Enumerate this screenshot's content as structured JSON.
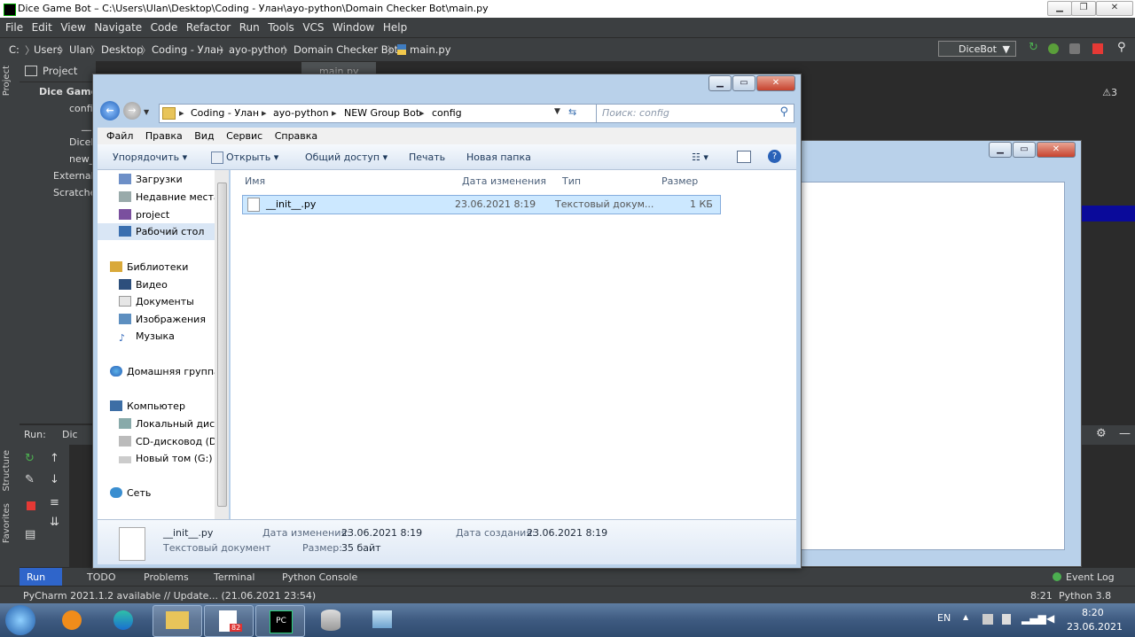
{
  "pycharm": {
    "title": "Dice Game Bot – C:\\Users\\Ulan\\Desktop\\Coding - Улан\\ayo-python\\Domain Checker Bot\\main.py",
    "menu": [
      "File",
      "Edit",
      "View",
      "Navigate",
      "Code",
      "Refactor",
      "Run",
      "Tools",
      "VCS",
      "Window",
      "Help"
    ],
    "breadcrumb": [
      "C:",
      "Users",
      "Ulan",
      "Desktop",
      "Coding - Улан",
      "ayo-python",
      "Domain Checker Bot",
      "main.py"
    ],
    "run_config": "DiceBot",
    "project_label": "Project",
    "tab": "main.py",
    "tree": [
      "Dice Game",
      "config",
      "__",
      "DiceB",
      "new_",
      "External",
      "Scratche"
    ],
    "warnings": "3",
    "run_label": "Run:",
    "run_tab": "Dic",
    "vertical_tabs": {
      "project": "Project",
      "structure": "Structure",
      "favorites": "Favorites"
    },
    "bottom_tabs": [
      "Run",
      "TODO",
      "Problems",
      "Terminal",
      "Python Console"
    ],
    "event_log": "Event Log",
    "status_text": "PyCharm 2021.1.2 available // Update... (21.06.2021 23:54)",
    "cursor_pos": "8:21",
    "interpreter": "Python 3.8"
  },
  "explorer": {
    "address": [
      "Coding - Улан",
      "ayo-python",
      "NEW Group Bot",
      "config"
    ],
    "search_placeholder": "Поиск: config",
    "menu": [
      "Файл",
      "Правка",
      "Вид",
      "Сервис",
      "Справка"
    ],
    "commands": {
      "organize": "Упорядочить",
      "open": "Открыть",
      "share": "Общий доступ",
      "print": "Печать",
      "new_folder": "Новая папка"
    },
    "nav": {
      "favorites": [
        "Загрузки",
        "Недавние места",
        "project",
        "Рабочий стол"
      ],
      "libraries": "Библиотеки",
      "library_items": [
        "Видео",
        "Документы",
        "Изображения",
        "Музыка"
      ],
      "homegroup": "Домашняя группа",
      "computer": "Компьютер",
      "drives": [
        "Локальный диск",
        "CD-дисковод (D:",
        "Новый том (G:)"
      ],
      "network": "Сеть"
    },
    "columns": [
      "Имя",
      "Дата изменения",
      "Тип",
      "Размер"
    ],
    "files": [
      {
        "name": "__init__.py",
        "modified": "23.06.2021 8:19",
        "type": "Текстовый докум...",
        "size": "1 КБ"
      }
    ],
    "details": {
      "name": "__init__.py",
      "kind": "Текстовый документ",
      "modified_label": "Дата изменения:",
      "modified": "23.06.2021 8:19",
      "created_label": "Дата создания:",
      "created": "23.06.2021 8:19",
      "size_label": "Размер:",
      "size": "35 байт"
    }
  },
  "taskbar": {
    "lang": "EN",
    "time": "8:20",
    "date": "23.06.2021",
    "badge": "82"
  },
  "colors": {
    "ide_bg": "#2b2b2b",
    "ide_panel": "#3c3f41",
    "explorer_frame": "#b9d1ea",
    "selection": "#cce8ff"
  }
}
